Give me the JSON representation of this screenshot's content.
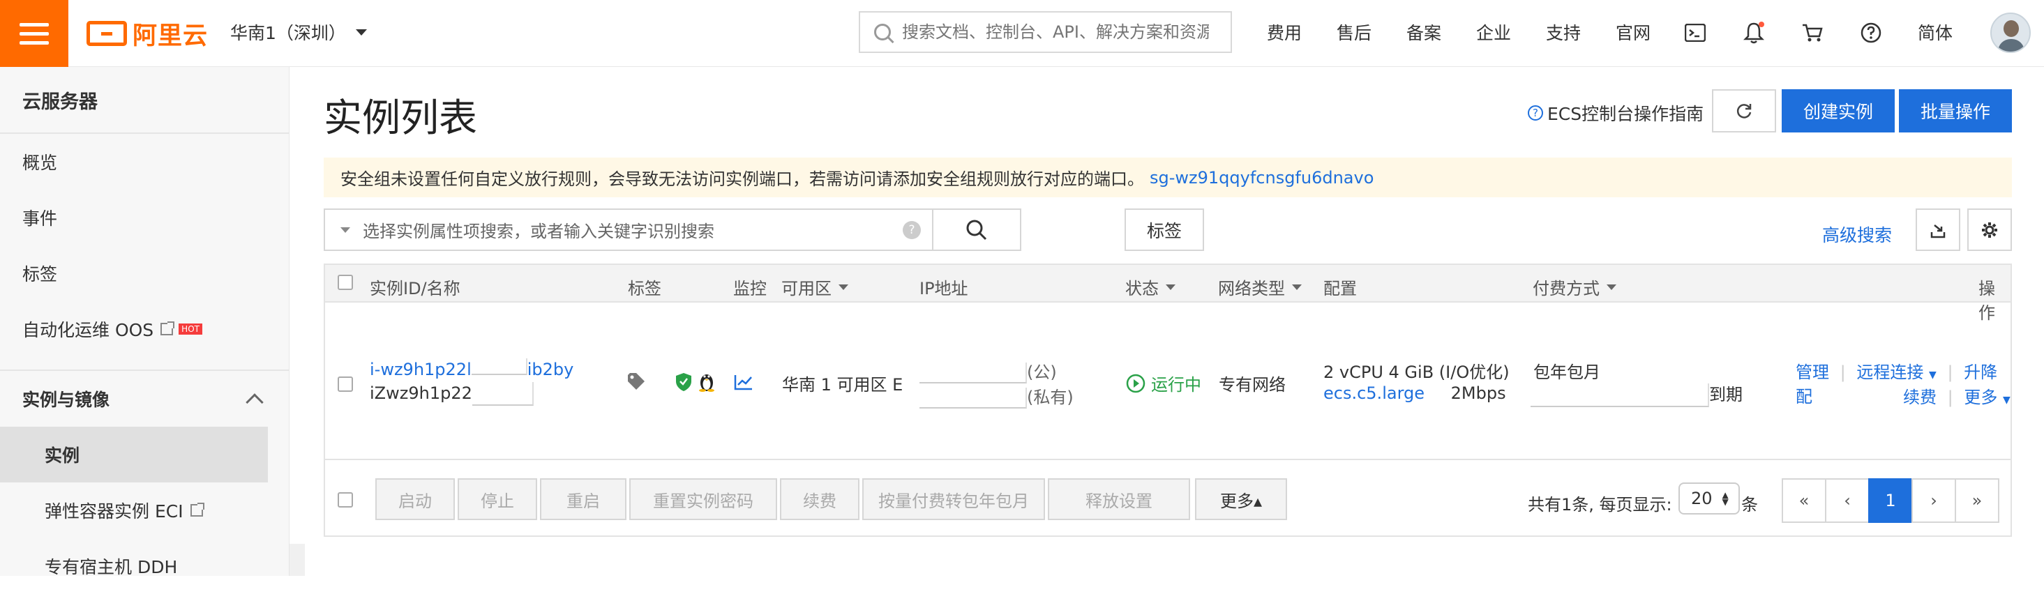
{
  "brand": {
    "logo_text": "阿里云",
    "accent": "#ff6a00",
    "primary": "#1e6fdc"
  },
  "header": {
    "region": "华南1（深圳）",
    "search_placeholder": "搜索文档、控制台、API、解决方案和资源",
    "links": [
      "费用",
      "售后",
      "备案",
      "企业",
      "支持",
      "官网"
    ],
    "icons": [
      "terminal-icon",
      "bell-icon",
      "cart-icon",
      "help-icon"
    ],
    "lang": "简体"
  },
  "sidebar": {
    "title": "云服务器",
    "items": [
      {
        "label": "概览"
      },
      {
        "label": "事件"
      },
      {
        "label": "标签"
      },
      {
        "label": "自动化运维 OOS",
        "badge": "HOT"
      }
    ],
    "group_title": "实例与镜像",
    "sub_items": [
      {
        "label": "实例",
        "active": true
      },
      {
        "label": "弹性容器实例 ECI"
      },
      {
        "label": "专有宿主机 DDH"
      }
    ]
  },
  "main": {
    "title": "实例列表",
    "guide_link": "ECS控制台操作指南",
    "create_button": "创建实例",
    "batch_button": "批量操作",
    "notice_text": "安全组未设置任何自定义放行规则，会导致无法访问实例端口，若需访问请添加安全组规则放行对应的端口。",
    "notice_link": "sg-wz91qqyfcnsgfu6dnavo",
    "filter_placeholder": "选择实例属性项搜索，或者输入关键字识别搜索",
    "tag_button": "标签",
    "advanced_search": "高级搜索"
  },
  "table": {
    "headers": {
      "id": "实例ID/名称",
      "tags": "标签",
      "monitor": "监控",
      "zone": "可用区",
      "ip": "IP地址",
      "status": "状态",
      "network": "网络类型",
      "config": "配置",
      "billing": "付费方式",
      "ops": "操作"
    },
    "row": {
      "id_prefix": "i-wz9h1p22l",
      "id_suffix": "ib2by",
      "name_prefix": "iZwz9h1p22",
      "zone": "华南 1 可用区 E",
      "ip_public_suffix": "(公)",
      "ip_private_suffix": "(私有)",
      "status": "运行中",
      "network": "专有网络",
      "config_line1": "2 vCPU 4 GiB (I/O优化)",
      "config_type": "ecs.c5.large",
      "config_bw": "2Mbps",
      "billing": "包年包月",
      "expire_suffix": "到期",
      "ops": {
        "manage": "管理",
        "remote": "远程连接",
        "upgrade": "升降配",
        "renew": "续费",
        "more": "更多"
      }
    },
    "footer_buttons": [
      "启动",
      "停止",
      "重启",
      "重置实例密码",
      "续费",
      "按量付费转包年包月",
      "释放设置"
    ],
    "footer_more": "更多▴",
    "page_info": "共有1条, 每页显示:",
    "page_size": "20",
    "page_unit": "条",
    "pager": [
      "«",
      "‹",
      "1",
      "›",
      "»"
    ]
  }
}
